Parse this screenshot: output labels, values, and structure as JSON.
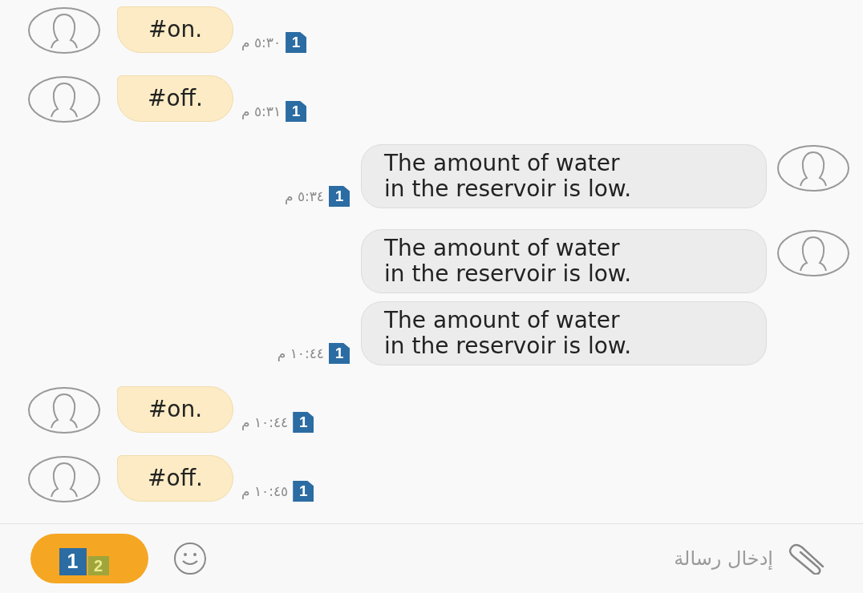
{
  "messages": [
    {
      "kind": "incoming",
      "text": "#on.",
      "avatar": true,
      "time": "٥:٣٠ م",
      "sim": "1"
    },
    {
      "kind": "incoming",
      "text": "#off.",
      "avatar": true,
      "time": "٥:٣١ م",
      "sim": "1"
    },
    {
      "kind": "outgoing",
      "lines": [
        "The amount of water",
        "in the reservoir is low."
      ],
      "avatar": true,
      "time": "٥:٣٤ م",
      "sim": "1"
    },
    {
      "kind": "outgoing",
      "lines": [
        "The amount of water",
        "in the reservoir is low."
      ],
      "avatar": true
    },
    {
      "kind": "outgoing",
      "lines": [
        "The amount of water",
        "in the reservoir is low."
      ],
      "avatar": false,
      "time": "١٠:٤٤ م",
      "sim": "1"
    },
    {
      "kind": "incoming",
      "text": "#on.",
      "avatar": true,
      "time": "١٠:٤٤ م",
      "sim": "1"
    },
    {
      "kind": "incoming",
      "text": "#off.",
      "avatar": true,
      "time": "١٠:٤٥ م",
      "sim": "1"
    }
  ],
  "composer": {
    "send_sim": "1",
    "other_sim": "2",
    "placeholder": "إدخال رسالة"
  }
}
